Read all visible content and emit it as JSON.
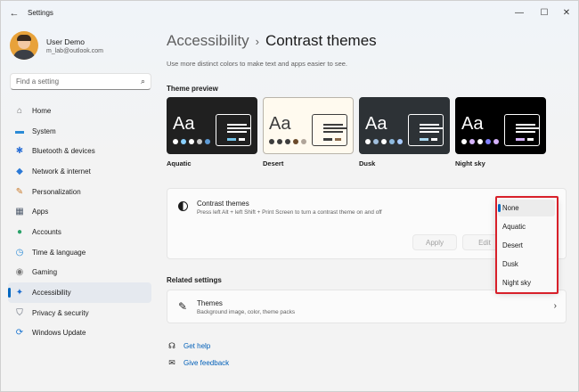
{
  "window": {
    "app_title": "Settings",
    "back_glyph": "←",
    "minimize_glyph": "—",
    "maximize_glyph": "☐",
    "close_glyph": "✕"
  },
  "profile": {
    "name": "User Demo",
    "email": "m_lab@outlook.com"
  },
  "search": {
    "placeholder": "Find a setting",
    "icon": "search-icon"
  },
  "sidebar": {
    "items": [
      {
        "label": "Home",
        "icon": "home-icon",
        "glyph": "⌂",
        "color": "#6b6b6b"
      },
      {
        "label": "System",
        "icon": "monitor-icon",
        "glyph": "▬",
        "color": "#2b8bd6"
      },
      {
        "label": "Bluetooth & devices",
        "icon": "bluetooth-icon",
        "glyph": "✱",
        "color": "#2b6fd6"
      },
      {
        "label": "Network & internet",
        "icon": "wifi-icon",
        "glyph": "◆",
        "color": "#2b79d6"
      },
      {
        "label": "Personalization",
        "icon": "brush-icon",
        "glyph": "✎",
        "color": "#c97a2a"
      },
      {
        "label": "Apps",
        "icon": "apps-icon",
        "glyph": "▦",
        "color": "#4e5a6b"
      },
      {
        "label": "Accounts",
        "icon": "person-icon",
        "glyph": "●",
        "color": "#2ba36a"
      },
      {
        "label": "Time & language",
        "icon": "globe-clock-icon",
        "glyph": "◷",
        "color": "#2b8bd6"
      },
      {
        "label": "Gaming",
        "icon": "controller-icon",
        "glyph": "◉",
        "color": "#7a7a7a"
      },
      {
        "label": "Accessibility",
        "icon": "accessibility-icon",
        "glyph": "✦",
        "color": "#1d6fd1",
        "active": true
      },
      {
        "label": "Privacy & security",
        "icon": "shield-icon",
        "glyph": "⛉",
        "color": "#5a6270"
      },
      {
        "label": "Windows Update",
        "icon": "update-icon",
        "glyph": "⟳",
        "color": "#1d76d1"
      }
    ]
  },
  "main": {
    "breadcrumb_parent": "Accessibility",
    "breadcrumb_sep": "›",
    "breadcrumb_current": "Contrast themes",
    "subtitle": "Use more distinct colors to make text and apps easier to see.",
    "theme_preview_title": "Theme preview",
    "themes": [
      {
        "label": "Aquatic",
        "bg": "#202020",
        "fg": "#ffffff",
        "win": "#202020",
        "border": "#ffffff",
        "dots": [
          "#ffffff",
          "#8ad0ff",
          "#ffffff",
          "#c9c9c9",
          "#5e9bd6"
        ],
        "accent": "#74c3e8",
        "accent2": "#ffffff"
      },
      {
        "label": "Desert",
        "bg": "#fffaef",
        "fg": "#3d3d3d",
        "win": "#fffaef",
        "border": "#3d3d3d",
        "dots": [
          "#3d3d3d",
          "#3d3d3d",
          "#3d3d3d",
          "#6b4a2a",
          "#b0a59a"
        ],
        "accent": "#3d3d3d",
        "accent2": "#8a6a4a"
      },
      {
        "label": "Dusk",
        "bg": "#2d3236",
        "fg": "#ffffff",
        "win": "#2d3236",
        "border": "#ffffff",
        "dots": [
          "#ffffff",
          "#a1bfde",
          "#ffffff",
          "#8fbbe0",
          "#aaccff"
        ],
        "accent": "#aad8f0",
        "accent2": "#ffffff"
      },
      {
        "label": "Night sky",
        "bg": "#000000",
        "fg": "#ffffff",
        "win": "#000000",
        "border": "#ffffff",
        "dots": [
          "#ffffff",
          "#d6b4fc",
          "#ffffff",
          "#8080ff",
          "#d6b4fc"
        ],
        "accent": "#d6b4fc",
        "accent2": "#ffffff"
      }
    ],
    "contrast_card": {
      "title": "Contrast themes",
      "description": "Press left Alt + left Shift + Print Screen to turn a contrast theme on and off",
      "apply_label": "Apply",
      "edit_label": "Edit"
    },
    "related_settings_title": "Related settings",
    "themes_card": {
      "title": "Themes",
      "description": "Background image, color, theme packs",
      "chevron": "›"
    },
    "help": [
      {
        "label": "Get help",
        "icon": "help-headset-icon",
        "glyph": "☊"
      },
      {
        "label": "Give feedback",
        "icon": "feedback-icon",
        "glyph": "✉"
      }
    ]
  },
  "dropdown": {
    "options": [
      "None",
      "Aquatic",
      "Desert",
      "Dusk",
      "Night sky"
    ],
    "selected": "None",
    "highlight_color": "#d8202a"
  }
}
